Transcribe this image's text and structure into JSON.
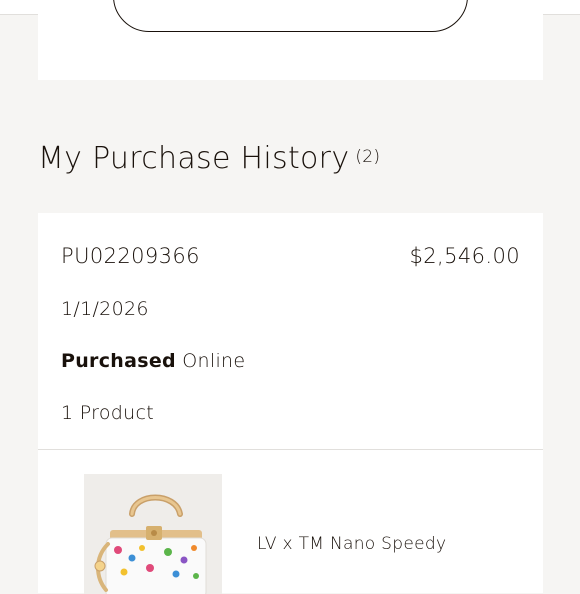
{
  "section": {
    "title": "My Purchase History",
    "count": "(2)"
  },
  "order": {
    "id": "PU02209366",
    "total": "$2,546.00",
    "date": "1/1/2026",
    "channel_label": "Purchased",
    "channel_value": "Online",
    "product_count": "1 Product"
  },
  "product": {
    "name": "LV x TM Nano Speedy",
    "image_icon": "handbag-image"
  },
  "colors": {
    "page_background": "#f6f5f3",
    "card_background": "#ffffff",
    "text": "#19110b"
  }
}
